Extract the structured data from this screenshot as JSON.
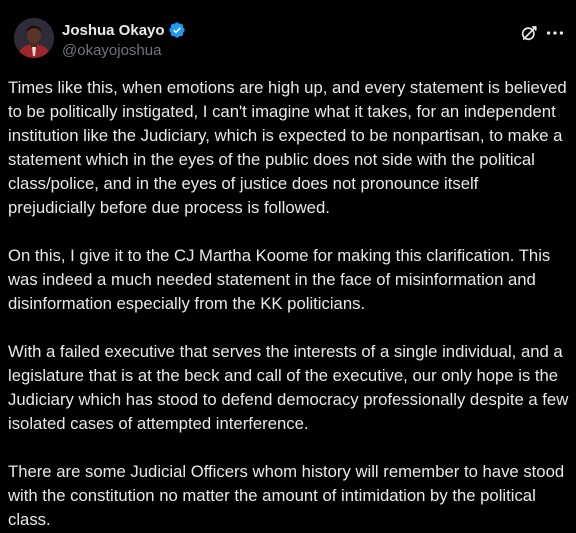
{
  "author": {
    "display_name": "Joshua Okayo",
    "handle": "@okayojoshua",
    "verified": true,
    "verified_color": "#1d9bf0"
  },
  "icons": {
    "avatar": "profile-photo",
    "verified": "verified-badge-icon",
    "grok": "grok-icon",
    "more": "more-options-icon"
  },
  "post": {
    "paragraphs": [
      "Times like this, when emotions are high up, and every statement is believed to be politically instigated, I can't imagine what it takes, for an independent institution like the Judiciary, which is expected to be nonpartisan, to make a statement which in the eyes of the public does not side with the political class/police, and in the eyes of justice does not pronounce itself prejudicially before due process is followed.",
      "On this, I give it to the CJ Martha Koome for making this clarification. This was indeed a much needed statement in the face of misinformation and disinformation especially from the KK politicians.",
      "With a failed executive that serves the interests of a single individual, and a legislature that is at the beck and call of the executive, our only hope is the Judiciary which has stood to defend democracy professionally despite a few isolated cases of attempted interference.",
      "There are some Judicial Officers whom history will remember to have stood with the constitution no matter the amount of intimidation by the political class."
    ]
  },
  "colors": {
    "background": "#000000",
    "text": "#e7e9ea",
    "secondary_text": "#71767b"
  }
}
